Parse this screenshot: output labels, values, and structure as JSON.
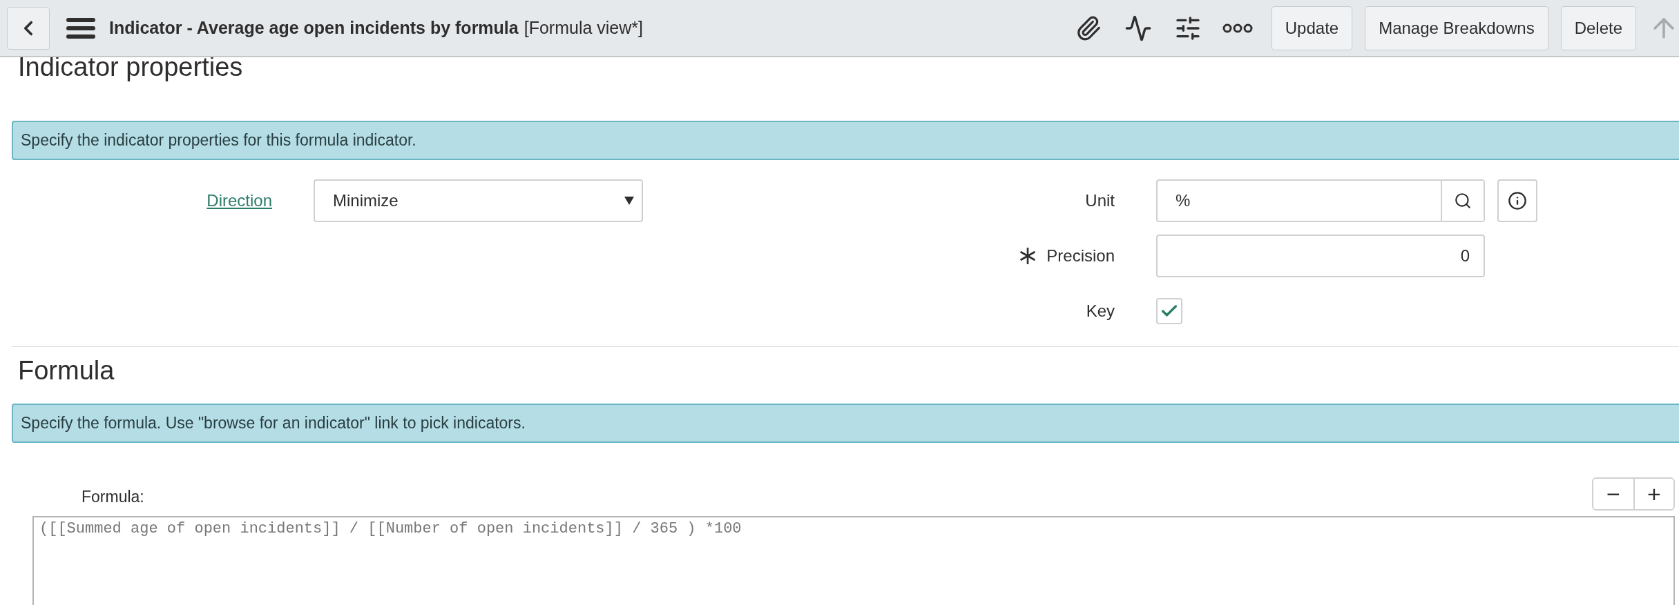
{
  "header": {
    "title": "Indicator - Average age open incidents by formula",
    "view": "[Formula view*]",
    "buttons": [
      "Update",
      "Manage Breakdowns",
      "Delete"
    ]
  },
  "properties": {
    "heading": "Indicator properties",
    "message": "Specify the indicator properties for this formula indicator.",
    "direction": {
      "label": "Direction",
      "value": "Minimize"
    },
    "unit": {
      "label": "Unit",
      "value": "%"
    },
    "precision": {
      "label": "Precision",
      "value": "0",
      "required": true
    },
    "key": {
      "label": "Key",
      "checked": true
    }
  },
  "formula": {
    "heading": "Formula",
    "message": "Specify the formula. Use \"browse for an indicator\" link to pick indicators.",
    "label": "Formula:",
    "zoom": [
      "−",
      "+"
    ],
    "value": "([[Summed age of open incidents]] / [[Number of open incidents]] / 365 ) *100"
  }
}
